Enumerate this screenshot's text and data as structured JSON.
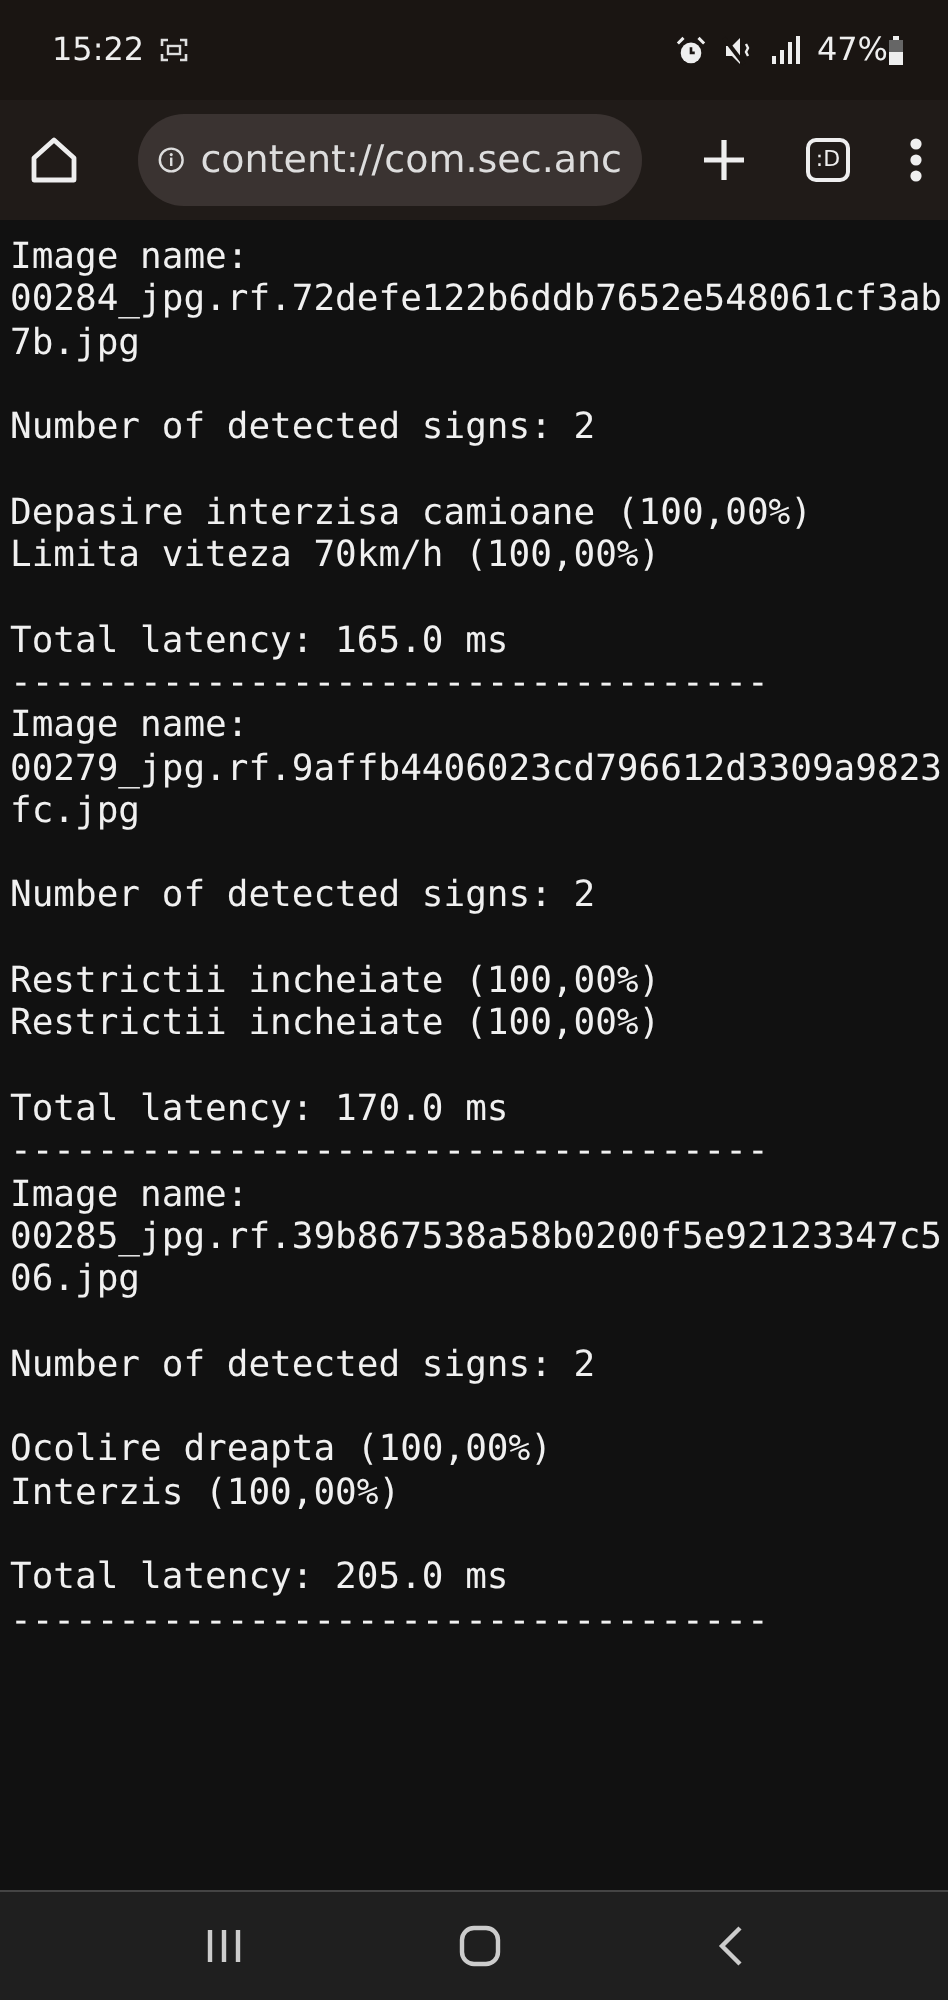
{
  "status_bar": {
    "time": "15:22",
    "battery": "47%"
  },
  "browser": {
    "url": "content://com.sec.anc",
    "tabs_label": ":D"
  },
  "records": [
    {
      "image_label": "Image name:",
      "image_name": "00284_jpg.rf.72defe122b6ddb7652e548061cf3ab7b.jpg",
      "detected": "Number of detected signs: 2",
      "signs": [
        "Depasire interzisa camioane (100,00%)",
        "Limita viteza 70km/h (100,00%)"
      ],
      "latency": "Total latency: 165.0 ms",
      "separator": "-----------------------------------"
    },
    {
      "image_label": "Image name:",
      "image_name": "00279_jpg.rf.9affb4406023cd796612d3309a9823fc.jpg",
      "detected": "Number of detected signs: 2",
      "signs": [
        "Restrictii incheiate (100,00%)",
        "Restrictii incheiate (100,00%)"
      ],
      "latency": "Total latency: 170.0 ms",
      "separator": "-----------------------------------"
    },
    {
      "image_label": "Image name:",
      "image_name": "00285_jpg.rf.39b867538a58b0200f5e92123347c506.jpg",
      "detected": "Number of detected signs: 2",
      "signs": [
        "Ocolire dreapta (100,00%)",
        "Interzis (100,00%)"
      ],
      "latency": "Total latency: 205.0 ms",
      "separator": "-----------------------------------"
    }
  ]
}
